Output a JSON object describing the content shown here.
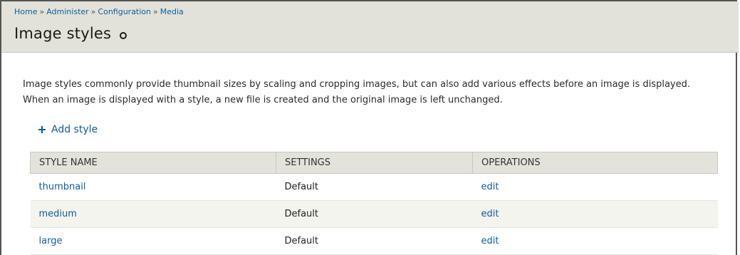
{
  "breadcrumb": {
    "items": [
      "Home",
      "Administer",
      "Configuration",
      "Media"
    ],
    "separator": "»"
  },
  "page": {
    "title": "Image styles",
    "description": "Image styles commonly provide thumbnail sizes by scaling and cropping images, but can also add various effects before an image is displayed. When an image is displayed with a style, a new file is created and the original image is left unchanged."
  },
  "actions": {
    "add_style_label": "Add style"
  },
  "table": {
    "headers": [
      "STYLE NAME",
      "SETTINGS",
      "OPERATIONS"
    ],
    "rows": [
      {
        "name": "thumbnail",
        "settings": "Default",
        "operation": "edit"
      },
      {
        "name": "medium",
        "settings": "Default",
        "operation": "edit"
      },
      {
        "name": "large",
        "settings": "Default",
        "operation": "edit"
      }
    ]
  },
  "colors": {
    "link": "#0d5e9a",
    "header_bg": "#e2e2da",
    "table_header_bg": "#e3e3dc",
    "row_alt_bg": "#f4f4ee"
  },
  "icons": {
    "shortcut": "shortcut-circle-icon",
    "add": "plus-icon"
  }
}
